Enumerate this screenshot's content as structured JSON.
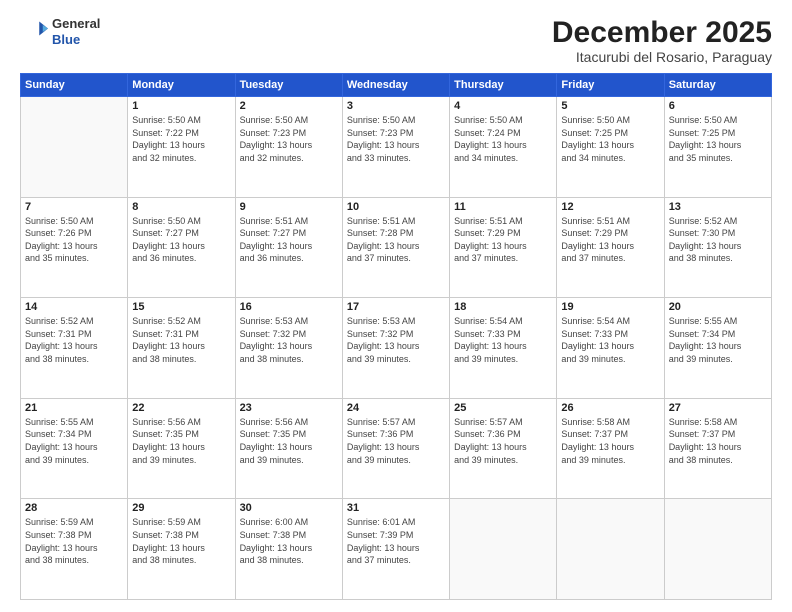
{
  "header": {
    "logo": {
      "general": "General",
      "blue": "Blue"
    },
    "title": "December 2025",
    "location": "Itacurubi del Rosario, Paraguay"
  },
  "weekdays": [
    "Sunday",
    "Monday",
    "Tuesday",
    "Wednesday",
    "Thursday",
    "Friday",
    "Saturday"
  ],
  "weeks": [
    [
      {
        "day": "",
        "info": ""
      },
      {
        "day": "1",
        "info": "Sunrise: 5:50 AM\nSunset: 7:22 PM\nDaylight: 13 hours\nand 32 minutes."
      },
      {
        "day": "2",
        "info": "Sunrise: 5:50 AM\nSunset: 7:23 PM\nDaylight: 13 hours\nand 32 minutes."
      },
      {
        "day": "3",
        "info": "Sunrise: 5:50 AM\nSunset: 7:23 PM\nDaylight: 13 hours\nand 33 minutes."
      },
      {
        "day": "4",
        "info": "Sunrise: 5:50 AM\nSunset: 7:24 PM\nDaylight: 13 hours\nand 34 minutes."
      },
      {
        "day": "5",
        "info": "Sunrise: 5:50 AM\nSunset: 7:25 PM\nDaylight: 13 hours\nand 34 minutes."
      },
      {
        "day": "6",
        "info": "Sunrise: 5:50 AM\nSunset: 7:25 PM\nDaylight: 13 hours\nand 35 minutes."
      }
    ],
    [
      {
        "day": "7",
        "info": "Sunrise: 5:50 AM\nSunset: 7:26 PM\nDaylight: 13 hours\nand 35 minutes."
      },
      {
        "day": "8",
        "info": "Sunrise: 5:50 AM\nSunset: 7:27 PM\nDaylight: 13 hours\nand 36 minutes."
      },
      {
        "day": "9",
        "info": "Sunrise: 5:51 AM\nSunset: 7:27 PM\nDaylight: 13 hours\nand 36 minutes."
      },
      {
        "day": "10",
        "info": "Sunrise: 5:51 AM\nSunset: 7:28 PM\nDaylight: 13 hours\nand 37 minutes."
      },
      {
        "day": "11",
        "info": "Sunrise: 5:51 AM\nSunset: 7:29 PM\nDaylight: 13 hours\nand 37 minutes."
      },
      {
        "day": "12",
        "info": "Sunrise: 5:51 AM\nSunset: 7:29 PM\nDaylight: 13 hours\nand 37 minutes."
      },
      {
        "day": "13",
        "info": "Sunrise: 5:52 AM\nSunset: 7:30 PM\nDaylight: 13 hours\nand 38 minutes."
      }
    ],
    [
      {
        "day": "14",
        "info": "Sunrise: 5:52 AM\nSunset: 7:31 PM\nDaylight: 13 hours\nand 38 minutes."
      },
      {
        "day": "15",
        "info": "Sunrise: 5:52 AM\nSunset: 7:31 PM\nDaylight: 13 hours\nand 38 minutes."
      },
      {
        "day": "16",
        "info": "Sunrise: 5:53 AM\nSunset: 7:32 PM\nDaylight: 13 hours\nand 38 minutes."
      },
      {
        "day": "17",
        "info": "Sunrise: 5:53 AM\nSunset: 7:32 PM\nDaylight: 13 hours\nand 39 minutes."
      },
      {
        "day": "18",
        "info": "Sunrise: 5:54 AM\nSunset: 7:33 PM\nDaylight: 13 hours\nand 39 minutes."
      },
      {
        "day": "19",
        "info": "Sunrise: 5:54 AM\nSunset: 7:33 PM\nDaylight: 13 hours\nand 39 minutes."
      },
      {
        "day": "20",
        "info": "Sunrise: 5:55 AM\nSunset: 7:34 PM\nDaylight: 13 hours\nand 39 minutes."
      }
    ],
    [
      {
        "day": "21",
        "info": "Sunrise: 5:55 AM\nSunset: 7:34 PM\nDaylight: 13 hours\nand 39 minutes."
      },
      {
        "day": "22",
        "info": "Sunrise: 5:56 AM\nSunset: 7:35 PM\nDaylight: 13 hours\nand 39 minutes."
      },
      {
        "day": "23",
        "info": "Sunrise: 5:56 AM\nSunset: 7:35 PM\nDaylight: 13 hours\nand 39 minutes."
      },
      {
        "day": "24",
        "info": "Sunrise: 5:57 AM\nSunset: 7:36 PM\nDaylight: 13 hours\nand 39 minutes."
      },
      {
        "day": "25",
        "info": "Sunrise: 5:57 AM\nSunset: 7:36 PM\nDaylight: 13 hours\nand 39 minutes."
      },
      {
        "day": "26",
        "info": "Sunrise: 5:58 AM\nSunset: 7:37 PM\nDaylight: 13 hours\nand 39 minutes."
      },
      {
        "day": "27",
        "info": "Sunrise: 5:58 AM\nSunset: 7:37 PM\nDaylight: 13 hours\nand 38 minutes."
      }
    ],
    [
      {
        "day": "28",
        "info": "Sunrise: 5:59 AM\nSunset: 7:38 PM\nDaylight: 13 hours\nand 38 minutes."
      },
      {
        "day": "29",
        "info": "Sunrise: 5:59 AM\nSunset: 7:38 PM\nDaylight: 13 hours\nand 38 minutes."
      },
      {
        "day": "30",
        "info": "Sunrise: 6:00 AM\nSunset: 7:38 PM\nDaylight: 13 hours\nand 38 minutes."
      },
      {
        "day": "31",
        "info": "Sunrise: 6:01 AM\nSunset: 7:39 PM\nDaylight: 13 hours\nand 37 minutes."
      },
      {
        "day": "",
        "info": ""
      },
      {
        "day": "",
        "info": ""
      },
      {
        "day": "",
        "info": ""
      }
    ]
  ]
}
